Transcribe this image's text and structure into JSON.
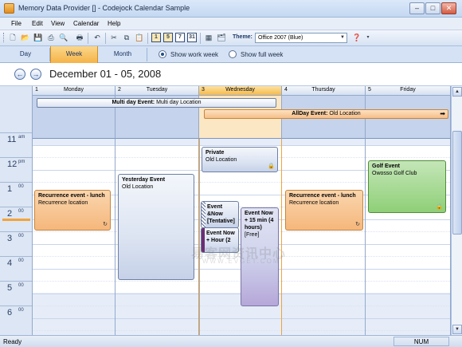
{
  "window": {
    "title": "Memory Data Provider [] - Codejock Calendar Sample",
    "minimize": "–",
    "maximize": "□",
    "close": "✕"
  },
  "menu": [
    "File",
    "Edit",
    "View",
    "Calendar",
    "Help"
  ],
  "toolbar": {
    "day_buttons": [
      "1",
      "5",
      "7",
      "31"
    ],
    "theme_label": "Theme:",
    "theme_value": "Office 2007 (Blue)"
  },
  "views": {
    "tabs": [
      "Day",
      "Week",
      "Month"
    ],
    "active_tab": "Week",
    "show_work_week": "Show work week",
    "show_full_week": "Show full week",
    "selected_option": "work"
  },
  "header": {
    "date_range": "December 01 - 05, 2008"
  },
  "days": [
    {
      "num": "1",
      "name": "Monday"
    },
    {
      "num": "2",
      "name": "Tuesday"
    },
    {
      "num": "3",
      "name": "Wednesday"
    },
    {
      "num": "4",
      "name": "Thursday"
    },
    {
      "num": "5",
      "name": "Friday"
    }
  ],
  "hours": [
    {
      "h": "11",
      "m": "am"
    },
    {
      "h": "12",
      "m": "pm"
    },
    {
      "h": "1",
      "m": "00"
    },
    {
      "h": "2",
      "m": "00"
    },
    {
      "h": "3",
      "m": "00"
    },
    {
      "h": "4",
      "m": "00"
    },
    {
      "h": "5",
      "m": "00"
    },
    {
      "h": "6",
      "m": "00"
    }
  ],
  "all_day_events": [
    {
      "title": "Multi day Event:",
      "location": "Multi day Location"
    },
    {
      "title": "AllDay Event:",
      "location": "Old Location"
    }
  ],
  "events": {
    "mon_recur": {
      "title": "Recurrence event - lunch",
      "location": "Recurrence location"
    },
    "tue_yesterday": {
      "title": "Yesterday Event",
      "location": "Old Location"
    },
    "wed_private": {
      "title": "Private",
      "location": "Old Location"
    },
    "wed_tentative": {
      "title": "Event &Now [Tentative]"
    },
    "wed_now2": {
      "title": "Event Now + Hour (2"
    },
    "wed_free": {
      "title": "Event Now + 15 min (4 hours)",
      "status": "[Free]"
    },
    "thu_recur": {
      "title": "Recurrence event - lunch",
      "location": "Recurrence location"
    },
    "fri_golf": {
      "title": "Golf Event",
      "location": "Owosso Golf Club"
    }
  },
  "watermark": {
    "line1": "易客网资讯中心",
    "line2": "WWW.EVGET.COM"
  },
  "status": {
    "left": "Ready",
    "num": "NUM"
  },
  "colors": {
    "accent": "#f5b347",
    "blue_event": "#dce4f2",
    "orange_event": "#f5b77c",
    "green_event": "#8fcf78"
  }
}
